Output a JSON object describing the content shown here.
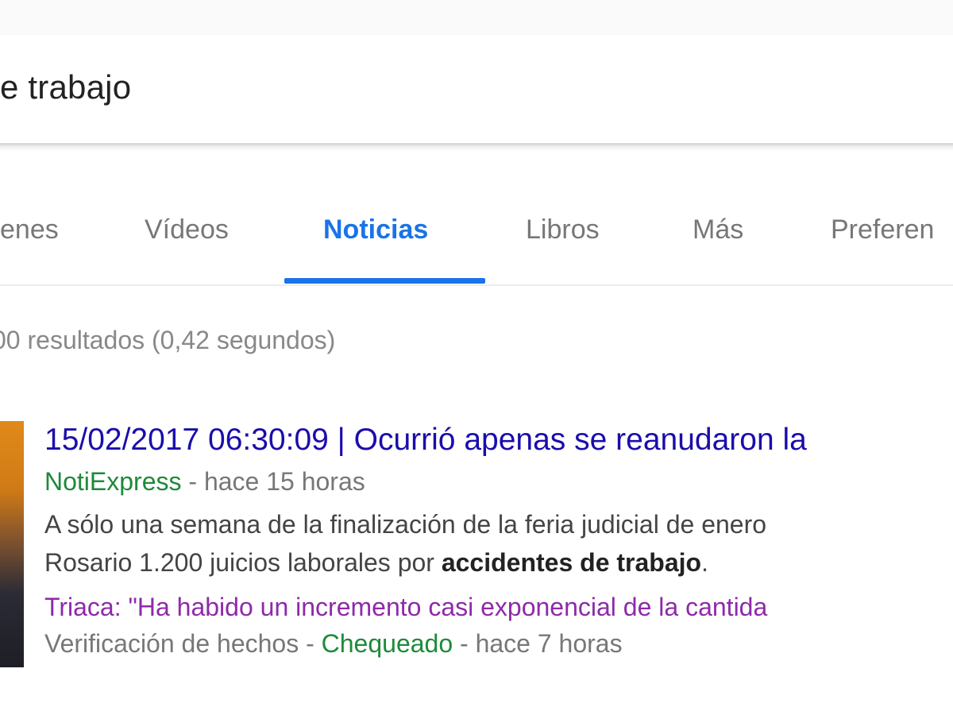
{
  "search": {
    "query": "e trabajo"
  },
  "tabs": [
    {
      "label": "enes",
      "active": false
    },
    {
      "label": "Vídeos",
      "active": false
    },
    {
      "label": "Noticias",
      "active": true
    },
    {
      "label": "Libros",
      "active": false
    },
    {
      "label": "Más",
      "active": false
    },
    {
      "label": "Preferen",
      "active": false
    }
  ],
  "stats": {
    "text": "00 resultados (0,42 segundos)"
  },
  "results": [
    {
      "title": "15/02/2017 06:30:09 | Ocurrió apenas se reanudaron la",
      "source": "NotiExpress",
      "age": " - hace 15 horas",
      "snippet_line1": "A sólo una semana de la finalización de la feria judicial de enero",
      "snippet_line2_pre": "Rosario 1.200 juicios laborales por ",
      "snippet_line2_bold": "accidentes de trabajo",
      "snippet_line2_post": "."
    }
  ],
  "related": {
    "title": "Triaca: \"Ha habido un incremento casi exponencial de la cantida",
    "label": "Verificación de hechos - ",
    "source": "Chequeado",
    "age": " - hace 7 horas"
  },
  "colors": {
    "accent": "#1a73e8",
    "link": "#1a0dab",
    "visited": "#8e2aa8",
    "source": "#1e8a3a"
  }
}
